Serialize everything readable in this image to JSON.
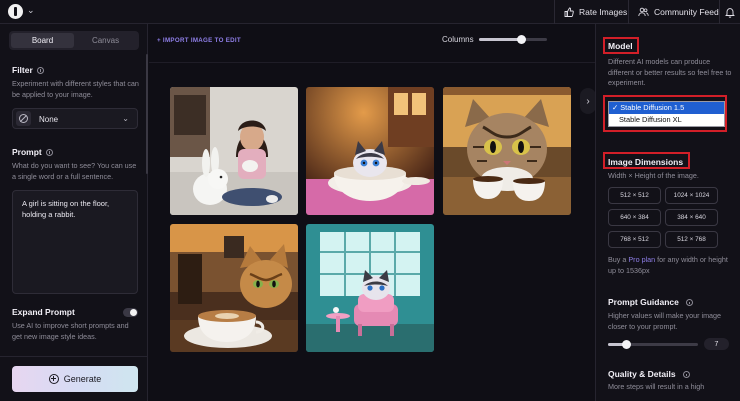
{
  "topbar": {
    "rate_images": "Rate Images",
    "community_feed": "Community Feed",
    "icons": [
      "logo-icon",
      "thumbs-up-icon",
      "users-icon",
      "bell-icon"
    ]
  },
  "left": {
    "tabs": [
      {
        "label": "Board",
        "active": true
      },
      {
        "label": "Canvas",
        "active": false
      }
    ],
    "filter": {
      "title": "Filter",
      "description": "Experiment with different styles that can be applied to your image.",
      "value": "None"
    },
    "prompt": {
      "title": "Prompt",
      "description": "What do you want to see? You can use a single word or a full sentence.",
      "value": "A girl is sitting on the floor, holding a rabbit."
    },
    "expand": {
      "title": "Expand Prompt",
      "description": "Use AI to improve short prompts and get new image style ideas.",
      "enabled": false
    },
    "generate_label": "Generate"
  },
  "center": {
    "import_label": "+ IMPORT IMAGE TO EDIT",
    "columns_label": "Columns",
    "columns_slider_fraction": 0.62,
    "images": [
      {
        "name": "image-girl-rabbit"
      },
      {
        "name": "image-cat-in-cup"
      },
      {
        "name": "image-cat-cafe-window"
      },
      {
        "name": "image-cat-latte"
      },
      {
        "name": "image-cat-pink-chair"
      }
    ]
  },
  "right": {
    "model": {
      "title": "Model",
      "description": "Different AI models can produce different or better results so feel free to experiment.",
      "options": [
        "Stable Diffusion 1.5",
        "Stable Diffusion XL"
      ],
      "selected_prefix": "✓ ",
      "selected": "Stable Diffusion 1.5"
    },
    "dimensions": {
      "title": "Image Dimensions",
      "description": "Width × Height of the image.",
      "sizes": [
        "512 × 512",
        "1024 × 1024",
        "640 × 384",
        "384 × 640",
        "768 × 512",
        "512 × 768"
      ],
      "pro_prefix": "Buy a ",
      "pro_link": "Pro plan",
      "pro_suffix": " for any width or height up to 1536px"
    },
    "guidance": {
      "title": "Prompt Guidance",
      "description": "Higher values will make your image closer to your prompt.",
      "value": "7",
      "slider_fraction": 0.2
    },
    "quality": {
      "title": "Quality & Details",
      "description": "More steps will result in a high"
    }
  },
  "colors": {
    "accent": "#8f7fe8",
    "highlight_box": "#d21f28",
    "selection_blue": "#1f5fd1"
  }
}
